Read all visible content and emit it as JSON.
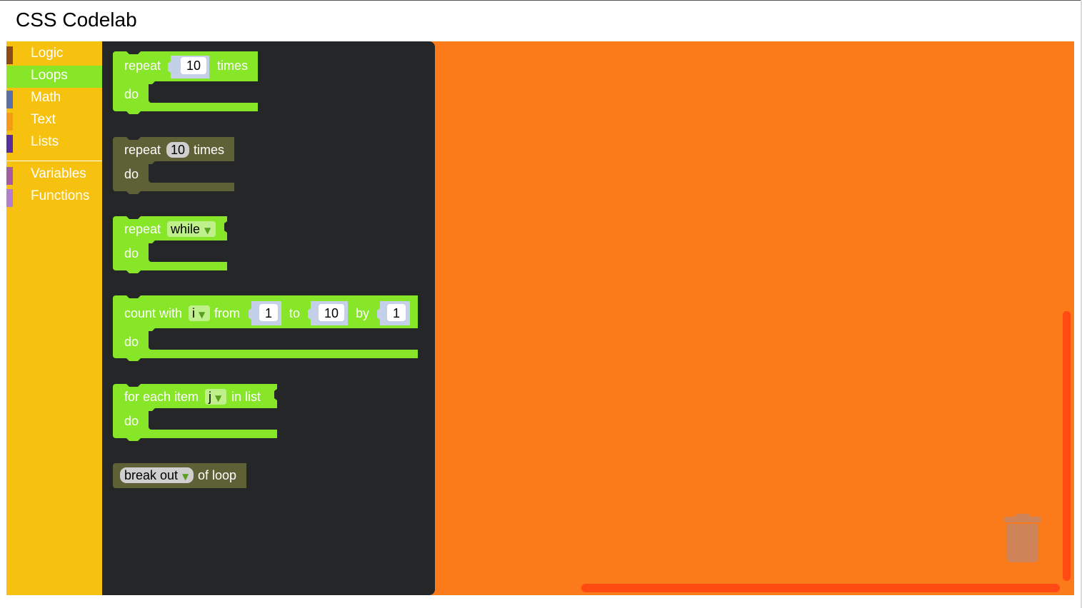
{
  "app": {
    "title": "CSS Codelab"
  },
  "toolbox": {
    "categories": [
      {
        "label": "Logic",
        "color": "#8b4a1a",
        "selected": false
      },
      {
        "label": "Loops",
        "color": "#86e627",
        "selected": true
      },
      {
        "label": "Math",
        "color": "#5b6fa8",
        "selected": false
      },
      {
        "label": "Text",
        "color": "#f59a16",
        "selected": false
      },
      {
        "label": "Lists",
        "color": "#5a2d9c",
        "selected": false
      },
      {
        "label": "Variables",
        "color": "#a35ba3",
        "selected": false
      },
      {
        "label": "Functions",
        "color": "#b27fd0",
        "selected": false
      }
    ]
  },
  "flyout": {
    "blocks": [
      {
        "id": "repeat-times",
        "text": [
          "repeat",
          "times"
        ],
        "value": "10",
        "do_label": "do"
      },
      {
        "id": "repeat-times-disabled",
        "text": [
          "repeat",
          "times"
        ],
        "value": "10",
        "do_label": "do",
        "disabled": true
      },
      {
        "id": "repeat-while",
        "text": [
          "repeat"
        ],
        "dropdown": "while",
        "do_label": "do"
      },
      {
        "id": "count-with",
        "text": [
          "count with",
          "from",
          "to",
          "by"
        ],
        "variable": "i",
        "from": "1",
        "to": "10",
        "by": "1",
        "do_label": "do"
      },
      {
        "id": "for-each",
        "text": [
          "for each item",
          "in list"
        ],
        "variable": "j",
        "do_label": "do"
      },
      {
        "id": "break-out",
        "dropdown": "break out",
        "text": [
          "of loop"
        ],
        "disabled": true
      }
    ]
  },
  "colors": {
    "workspace": "#fb7a19",
    "toolbox": "#f7c110",
    "flyout": "#252627",
    "loop_block": "#86e627",
    "disabled_block": "#5e6135",
    "scrollbar": "#ff4a14"
  },
  "workspace": {
    "trash_icon": "trash-icon"
  }
}
